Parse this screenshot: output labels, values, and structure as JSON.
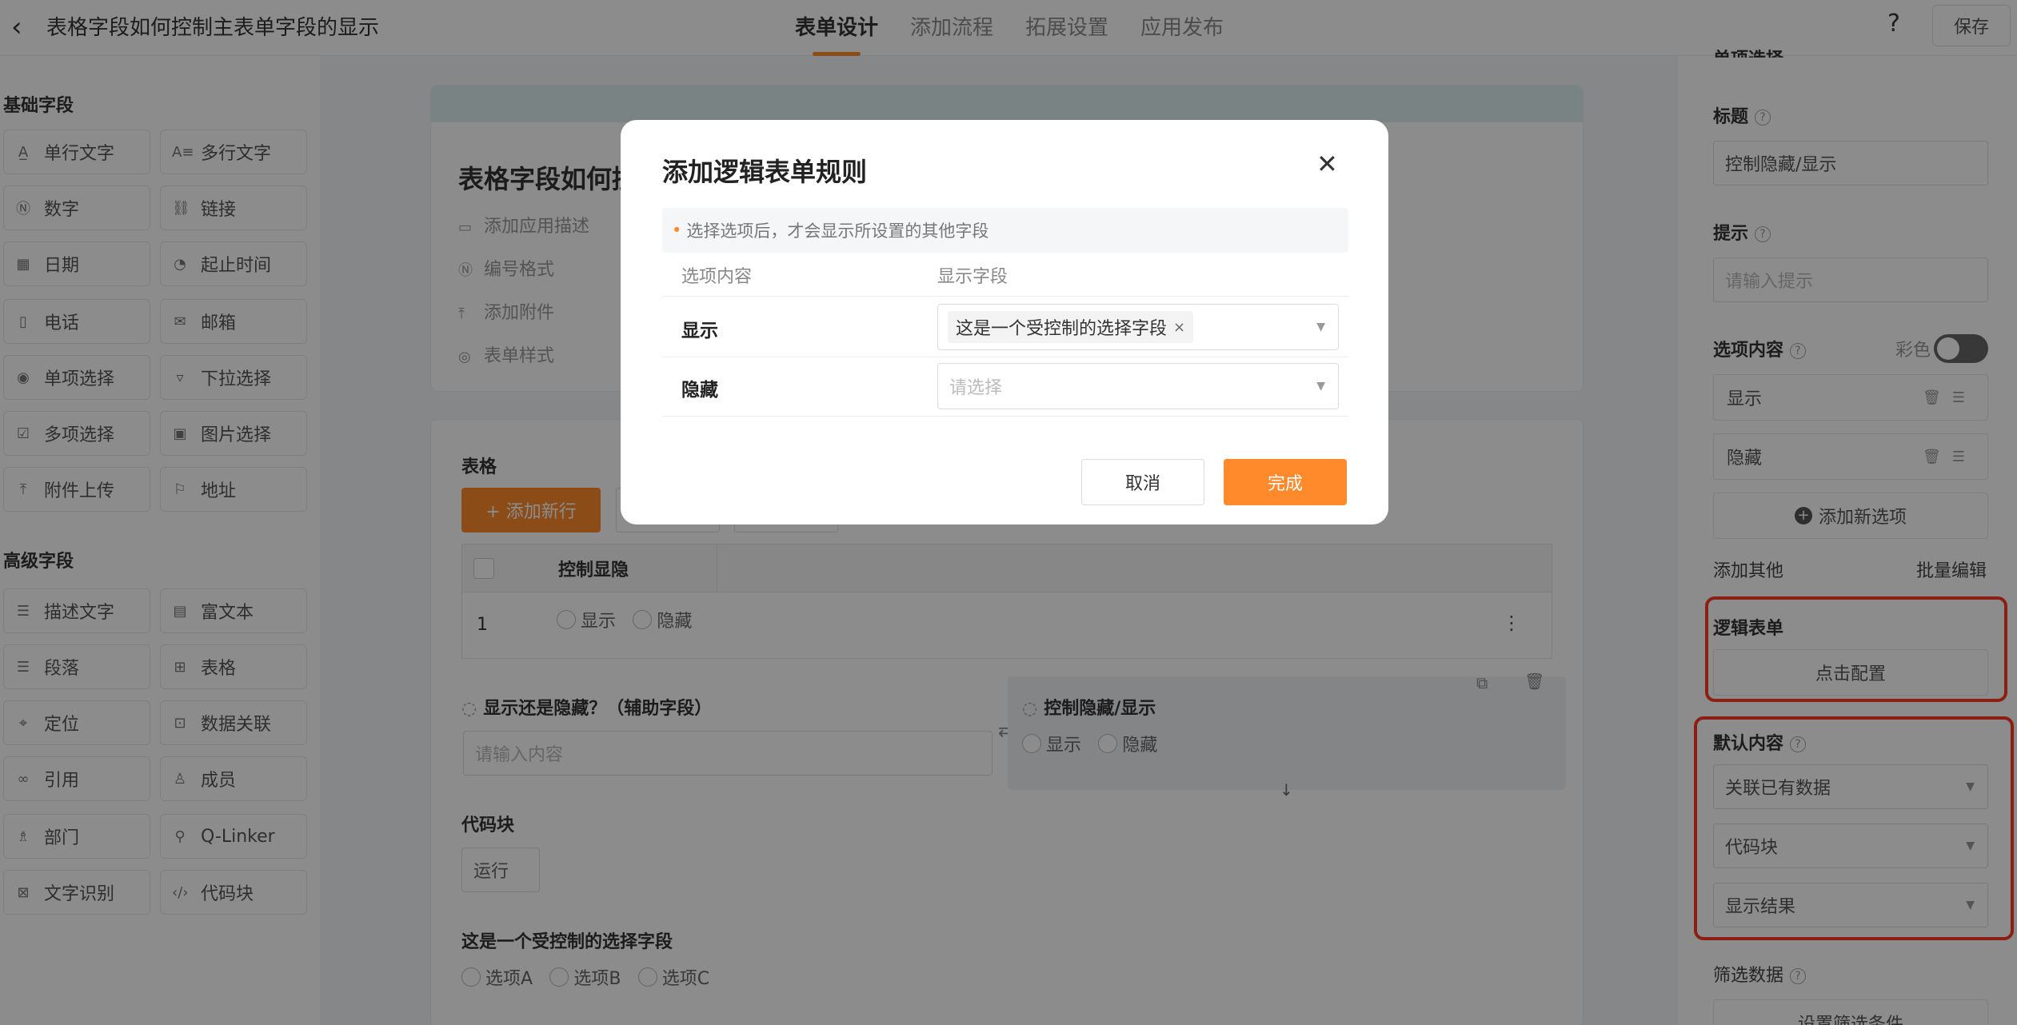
{
  "header": {
    "back_icon": "chevron-left-icon",
    "app_title": "表格字段如何控制主表单字段的显示",
    "tabs": [
      {
        "label": "表单设计"
      },
      {
        "label": "添加流程"
      },
      {
        "label": "拓展设置"
      },
      {
        "label": "应用发布"
      }
    ],
    "help": "?",
    "save_label": "保存",
    "accent": "#ff8a2b"
  },
  "left": {
    "basic_title": "基础字段",
    "basic_fields": [
      {
        "label": "单行文字",
        "icon": "text-icon"
      },
      {
        "label": "多行文字",
        "icon": "multiline-text-icon"
      },
      {
        "label": "数字",
        "icon": "number-icon"
      },
      {
        "label": "链接",
        "icon": "link-icon"
      },
      {
        "label": "日期",
        "icon": "calendar-icon"
      },
      {
        "label": "起止时间",
        "icon": "time-range-icon"
      },
      {
        "label": "电话",
        "icon": "phone-icon"
      },
      {
        "label": "邮箱",
        "icon": "mail-icon"
      },
      {
        "label": "单项选择",
        "icon": "radio-icon"
      },
      {
        "label": "下拉选择",
        "icon": "dropdown-icon"
      },
      {
        "label": "多项选择",
        "icon": "checkbox-icon"
      },
      {
        "label": "图片选择",
        "icon": "image-icon"
      },
      {
        "label": "附件上传",
        "icon": "upload-icon"
      },
      {
        "label": "地址",
        "icon": "address-icon"
      }
    ],
    "advanced_title": "高级字段",
    "advanced_fields": [
      {
        "label": "描述文字",
        "icon": "description-icon"
      },
      {
        "label": "富文本",
        "icon": "rich-text-icon"
      },
      {
        "label": "段落",
        "icon": "paragraph-icon"
      },
      {
        "label": "表格",
        "icon": "table-icon"
      },
      {
        "label": "定位",
        "icon": "location-icon"
      },
      {
        "label": "数据关联",
        "icon": "data-link-icon"
      },
      {
        "label": "引用",
        "icon": "reference-icon"
      },
      {
        "label": "成员",
        "icon": "member-icon"
      },
      {
        "label": "部门",
        "icon": "department-icon"
      },
      {
        "label": "Q-Linker",
        "icon": "q-linker-icon"
      },
      {
        "label": "文字识别",
        "icon": "ocr-icon"
      },
      {
        "label": "代码块",
        "icon": "code-icon"
      }
    ]
  },
  "form": {
    "title": "表格字段如何控",
    "meta": [
      {
        "label": "添加应用描述",
        "icon": "description-icon"
      },
      {
        "label": "编号格式",
        "icon": "number-format-icon"
      },
      {
        "label": "添加附件",
        "icon": "attachment-icon"
      },
      {
        "label": "表单样式",
        "icon": "style-icon"
      }
    ],
    "table_label": "表格",
    "add_row": "+ 添加新行",
    "table_header": "控制显隐",
    "row_index": "1",
    "row_options": [
      "显示",
      "隐藏"
    ],
    "aux_field_label": "显示还是隐藏？（辅助字段）",
    "aux_placeholder": "请输入内容",
    "ctrl_field_label": "控制隐藏/显示",
    "ctrl_options": [
      "显示",
      "隐藏"
    ],
    "code_label": "代码块",
    "run_label": "运行",
    "controlled_label": "这是一个受控制的选择字段",
    "controlled_options": [
      "选项A",
      "选项B",
      "选项C"
    ]
  },
  "right": {
    "top_partial": "单项选择",
    "title_label": "标题",
    "title_value": "控制隐藏/显示",
    "hint_label": "提示",
    "hint_placeholder": "请输入提示",
    "options_label": "选项内容",
    "color_label": "彩色",
    "options": [
      "显示",
      "隐藏"
    ],
    "add_option": "添加新选项",
    "add_other": "添加其他",
    "batch_edit": "批量编辑",
    "logic_label": "逻辑表单",
    "logic_button": "点击配置",
    "default_label": "默认内容",
    "default_selects": [
      "关联已有数据",
      "代码块",
      "显示结果"
    ],
    "filter_label": "筛选数据",
    "filter_button": "设置筛选条件",
    "highlight_color": "#ff3a22"
  },
  "modal": {
    "title": "添加逻辑表单规则",
    "notice": "选择选项后，才会显示所设置的其他字段",
    "col_option": "选项内容",
    "col_field": "显示字段",
    "rows": [
      {
        "option": "显示",
        "tag": "这是一个受控制的选择字段"
      },
      {
        "option": "隐藏",
        "placeholder": "请选择"
      }
    ],
    "cancel": "取消",
    "confirm": "完成"
  }
}
